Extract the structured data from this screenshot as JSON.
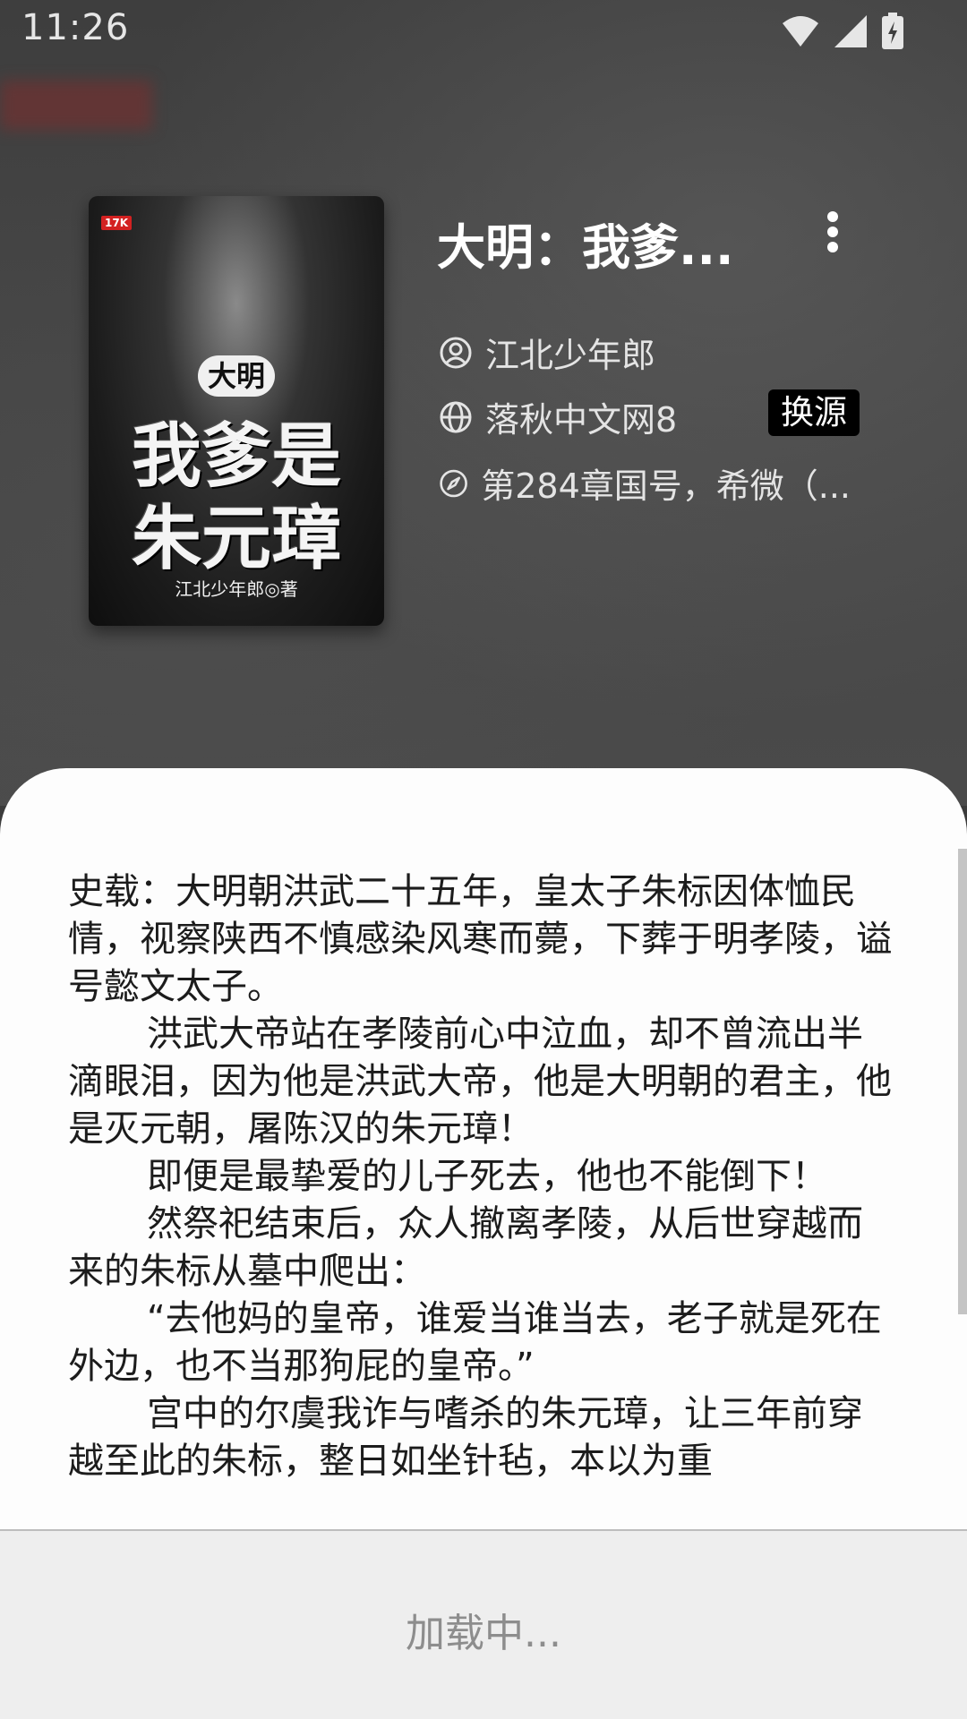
{
  "status_bar": {
    "time": "11:26",
    "icons": [
      "wifi-icon",
      "signal-icon",
      "battery-charging-icon"
    ]
  },
  "book": {
    "title": "大明：我爹...",
    "author": "江北少年郎",
    "source": "落秋中文网8",
    "latest_chapter": "第284章国号，希微（...",
    "switch_source_label": "换源"
  },
  "cover": {
    "badge": "17K",
    "title_line_1": "大明",
    "title_line_2": "我爹是",
    "title_line_3": "朱元璋",
    "author_line": "江北少年郎◎著"
  },
  "intro": {
    "paragraphs": [
      "史载：大明朝洪武二十五年，皇太子朱标因体恤民情，视察陕西不慎感染风寒而薨，下葬于明孝陵，谥号懿文太子。",
      "洪武大帝站在孝陵前心中泣血，却不曾流出半滴眼泪，因为他是洪武大帝，他是大明朝的君主，他是灭元朝，屠陈汉的朱元璋！",
      "即便是最挚爱的儿子死去，他也不能倒下！",
      "然祭祀结束后，众人撤离孝陵，从后世穿越而来的朱标从墓中爬出：",
      "“去他妈的皇帝，谁爱当谁当去，老子就是死在外边，也不当那狗屁的皇帝。”",
      "宫中的尔虞我诈与嗜杀的朱元璋，让三年前穿越至此的朱标，整日如坐针毡，本以为重"
    ]
  },
  "footer": {
    "loading_text": "加载中..."
  }
}
